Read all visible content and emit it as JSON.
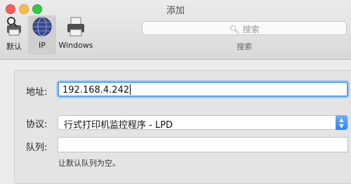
{
  "window": {
    "title": "添加"
  },
  "toolbar": {
    "items": [
      {
        "label": "默认",
        "icon": "default-printer-icon"
      },
      {
        "label": "IP",
        "icon": "globe-icon",
        "selected": true
      },
      {
        "label": "Windows",
        "icon": "windows-printer-icon"
      }
    ]
  },
  "search": {
    "placeholder": "搜索",
    "caption": "搜索"
  },
  "form": {
    "address_label": "地址:",
    "address_value": "192.168.4.242",
    "protocol_label": "协议:",
    "protocol_value": "行式打印机监控程序 - LPD",
    "queue_label": "队列:",
    "queue_value": "",
    "queue_hint": "让默认队列为空。"
  },
  "colors": {
    "accent": "#3b88f5",
    "focus_ring": "#5a9ef5"
  }
}
